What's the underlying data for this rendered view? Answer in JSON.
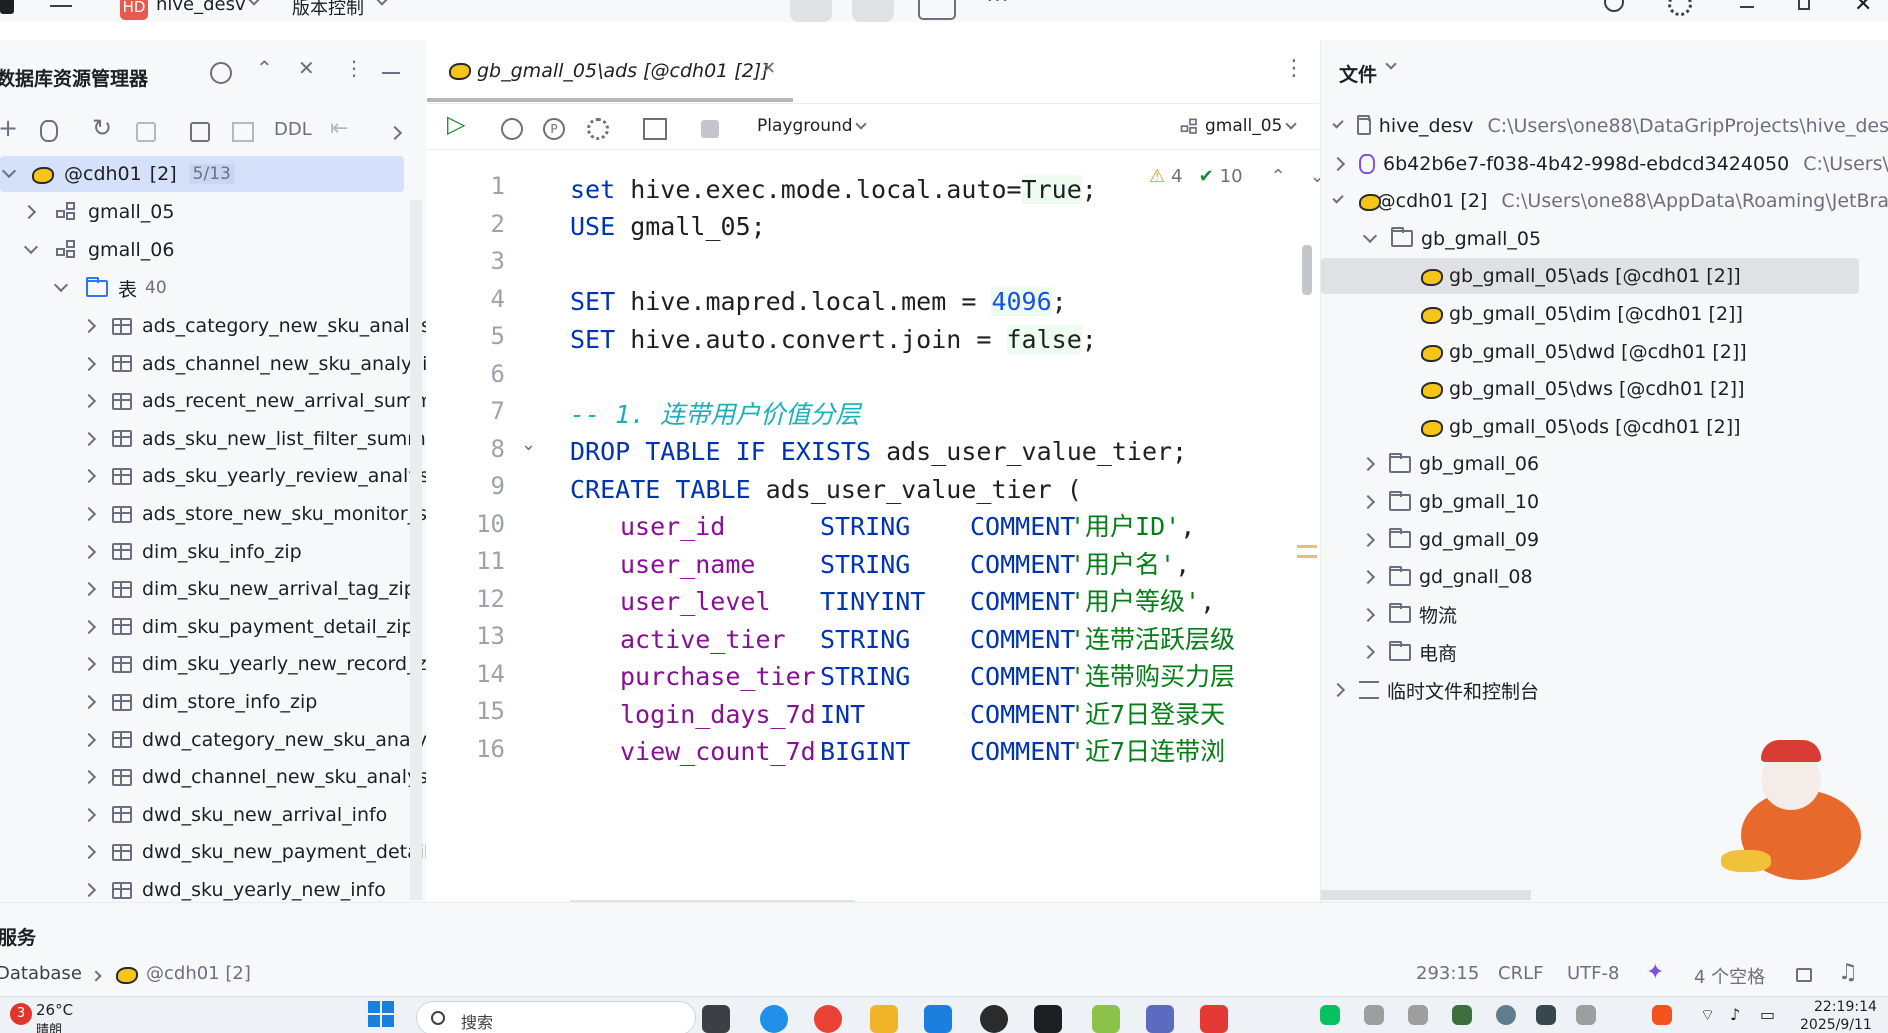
{
  "titlebar": {
    "project_badge": "HD",
    "project_name": "hive_desv",
    "vcs_label": "版本控制"
  },
  "left_panel": {
    "title": "数据库资源管理器",
    "toolbar_ddl": "DDL",
    "datasource": {
      "name": "@cdh01",
      "index": "[2]",
      "count": "5/13"
    },
    "schemas": [
      {
        "name": "gmall_05",
        "expanded": false
      },
      {
        "name": "gmall_06",
        "expanded": true
      }
    ],
    "tables_folder": {
      "label": "表",
      "count": "40"
    },
    "tables": [
      "ads_category_new_sku_analysi",
      "ads_channel_new_sku_analysis",
      "ads_recent_new_arrival_summ",
      "ads_sku_new_list_filter_summa",
      "ads_sku_yearly_review_analysis",
      "ads_store_new_sku_monitor_su",
      "dim_sku_info_zip",
      "dim_sku_new_arrival_tag_zip",
      "dim_sku_payment_detail_zip",
      "dim_sku_yearly_new_record_zi",
      "dim_store_info_zip",
      "dwd_category_new_sku_analys",
      "dwd_channel_new_sku_analysi",
      "dwd_sku_new_arrival_info",
      "dwd_sku_new_payment_detail",
      "dwd_sku_yearly_new_info"
    ]
  },
  "editor": {
    "tab_title": "gb_gmall_05\\ads [@cdh01 [2]]",
    "playground_label": "Playground",
    "schema_selector": "gmall_05",
    "warnings": "4",
    "checks": "10",
    "line_numbers": [
      "1",
      "2",
      "3",
      "4",
      "5",
      "6",
      "7",
      "8",
      "9",
      "10",
      "11",
      "12",
      "13",
      "14",
      "15",
      "16"
    ],
    "lines": {
      "l1": {
        "kw": "set",
        "rest": " hive.exec.mode.local.auto=",
        "val": "True",
        "end": ";"
      },
      "l2": {
        "kw": "USE",
        "rest": " gmall_05;"
      },
      "l4": {
        "kw": "SET",
        "rest": " hive.mapred.local.mem = ",
        "val": "4096",
        "end": ";"
      },
      "l5": {
        "kw": "SET",
        "rest": " hive.auto.convert.join = ",
        "val": "false",
        "end": ";"
      },
      "l7": {
        "comment": "-- 1. 连带用户价值分层"
      },
      "l8": {
        "kw": "DROP TABLE IF EXISTS",
        "rest": " ads_user_value_tier;"
      },
      "l9": {
        "kw": "CREATE TABLE",
        "rest": " ads_user_value_tier ("
      },
      "cols": [
        {
          "name": "user_id",
          "type": "STRING",
          "kw": "COMMENT",
          "str": "'用户ID'",
          "end": ","
        },
        {
          "name": "user_name",
          "type": "STRING",
          "kw": "COMMENT",
          "str": "'用户名'",
          "end": ","
        },
        {
          "name": "user_level",
          "type": "TINYINT",
          "kw": "COMMENT",
          "str": "'用户等级'",
          "end": ","
        },
        {
          "name": "active_tier",
          "type": "STRING",
          "kw": "COMMENT",
          "str": "'连带活跃层级",
          "end": ""
        },
        {
          "name": "purchase_tier",
          "type": "STRING",
          "kw": "COMMENT",
          "str": "'连带购买力层",
          "end": ""
        },
        {
          "name": "login_days_7d",
          "type": "INT",
          "kw": "COMMENT",
          "str": "'近7日登录天",
          "end": ""
        },
        {
          "name": "view_count_7d",
          "type": "BIGINT",
          "kw": "COMMENT",
          "str": "'近7日连带浏",
          "end": ""
        }
      ]
    }
  },
  "right_panel": {
    "title": "文件",
    "rows": [
      {
        "label": "hive_desv",
        "path": "C:\\Users\\one88\\DataGripProjects\\hive_des"
      },
      {
        "label": "6b42b6e7-f038-4b42-998d-ebdcd3424050",
        "path": "C:\\Users\\"
      },
      {
        "label": "@cdh01  [2]",
        "path": "C:\\Users\\one88\\AppData\\Roaming\\JetBra"
      },
      {
        "label": "gb_gmall_05"
      },
      {
        "label": "gb_gmall_05\\ads [@cdh01 [2]]"
      },
      {
        "label": "gb_gmall_05\\dim [@cdh01 [2]]"
      },
      {
        "label": "gb_gmall_05\\dwd [@cdh01 [2]]"
      },
      {
        "label": "gb_gmall_05\\dws [@cdh01 [2]]"
      },
      {
        "label": "gb_gmall_05\\ods [@cdh01 [2]]"
      },
      {
        "label": "gb_gmall_06"
      },
      {
        "label": "gb_gmall_10"
      },
      {
        "label": "gd_gmall_09"
      },
      {
        "label": "gd_gnall_08"
      },
      {
        "label": "物流"
      },
      {
        "label": "电商"
      },
      {
        "label": "临时文件和控制台"
      }
    ]
  },
  "services": {
    "title": "服务",
    "breadcrumb_root": "Database",
    "breadcrumb_ds": "@cdh01 [2]"
  },
  "statusbar": {
    "position": "293:15",
    "line_sep": "CRLF",
    "encoding": "UTF-8",
    "indent": "4 个空格"
  },
  "taskbar": {
    "weather_badge": "3",
    "temperature": "26°C",
    "weather_text": "晴朗",
    "search_placeholder": "搜索",
    "time": "22:19:14",
    "date": "2025/9/11"
  },
  "colors": {
    "accent": "#3574f0",
    "keyword": "#0033b3",
    "field": "#871094",
    "string": "#067d17",
    "selection": "#dfe1e5"
  }
}
